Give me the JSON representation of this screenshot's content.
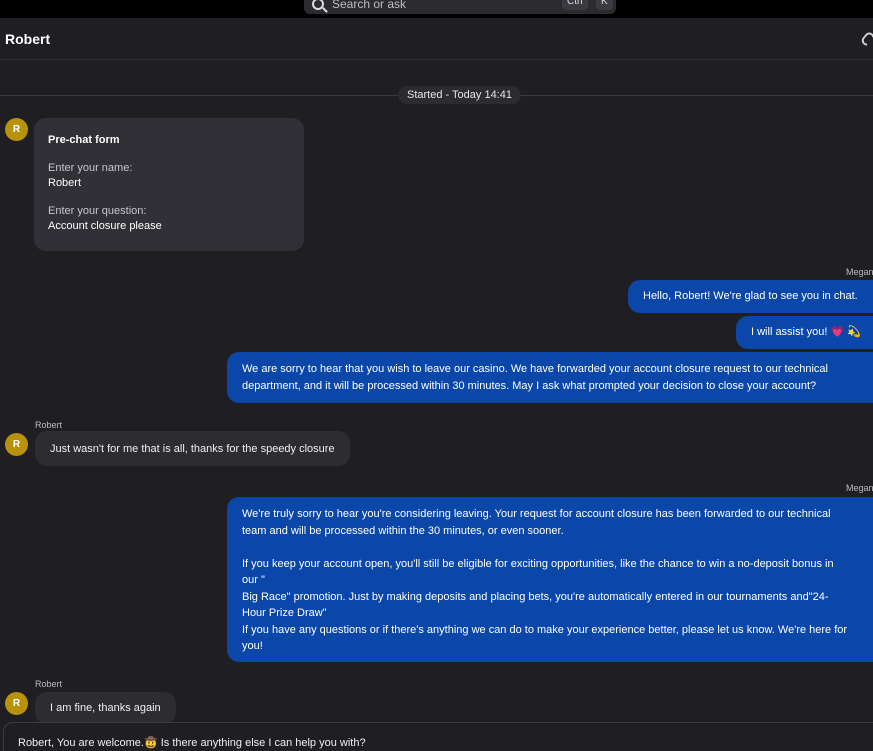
{
  "search": {
    "placeholder": "Search or ask",
    "kbd1": "Ctrl",
    "kbd2": "K"
  },
  "header": {
    "contact_name": "Robert"
  },
  "timeline": {
    "started": "Started - Today 14:41"
  },
  "avatar_letter": "R",
  "prechat": {
    "title": "Pre-chat form",
    "name_label": "Enter your name:",
    "name_value": "Robert",
    "question_label": "Enter your question:",
    "question_value": "Account closure please"
  },
  "messages": {
    "agent_name": "Megan",
    "customer_name": "Robert",
    "agent_1": "Hello, Robert! We're glad to see you in chat.",
    "agent_2": "I will assist you! 💗 💫",
    "agent_3_line1": "We are sorry to hear that you wish to leave our casino. We have forwarded your account closure request to our technical",
    "agent_3_line2": "department, and it will be processed within 30 minutes. May I ask what prompted your decision to close your account?",
    "customer_1": "Just wasn't for me that is all, thanks for the speedy closure",
    "agent_4_line1": "We're truly sorry to hear you're considering leaving. Your request for account closure has been forwarded to our technical",
    "agent_4_line2": "team and will be processed within the 30 minutes, or even sooner.",
    "agent_4_line3": "If you keep your account open, you'll still be eligible for exciting opportunities, like the chance to win a no-deposit bonus in",
    "agent_4_line4": "our \"",
    "agent_4_line5": "Big Race\" promotion. Just by making deposits and placing bets, you're automatically entered in our tournaments and\"24-",
    "agent_4_line6": "Hour Prize Draw\"",
    "agent_4_line7": "If you have any questions or if there's anything we can do to make your experience better, please let us know. We're here for",
    "agent_4_line8": "you!",
    "customer_2": "I am fine, thanks again"
  },
  "composer": {
    "value": "Robert, You are welcome.🤠 Is there anything else I can help you with?"
  }
}
